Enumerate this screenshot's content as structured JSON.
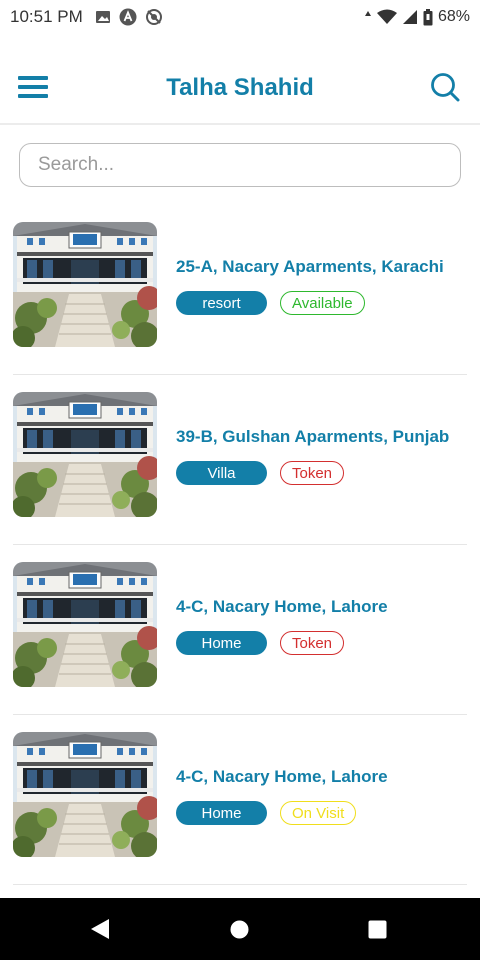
{
  "status_bar": {
    "time": "10:51 PM",
    "left_icons": [
      "image-icon",
      "app-icon",
      "no-sync-icon"
    ],
    "right_icons": [
      "data-arrows-icon",
      "wifi-icon",
      "signal-icon",
      "battery-icon"
    ],
    "battery": "68%"
  },
  "app_bar": {
    "title": "Talha Shahid",
    "menu_icon": "menu-icon",
    "search_icon": "search-icon",
    "accent_color": "#137fa8"
  },
  "search": {
    "placeholder": "Search..."
  },
  "listings": [
    {
      "title": "25-A, Nacary Aparments, Karachi",
      "type": "resort",
      "status": "Available",
      "status_color": "#2eb82e"
    },
    {
      "title": "39-B, Gulshan Aparments, Punjab",
      "type": "Villa",
      "status": "Token",
      "status_color": "#d32f2f"
    },
    {
      "title": "4-C, Nacary Home, Lahore",
      "type": "Home",
      "status": "Token",
      "status_color": "#d32f2f"
    },
    {
      "title": "4-C, Nacary Home, Lahore",
      "type": "Home",
      "status": "On Visit",
      "status_color": "#f0de1c"
    }
  ],
  "nav_bar": {
    "buttons": [
      "back-icon",
      "home-icon",
      "recents-icon"
    ]
  }
}
